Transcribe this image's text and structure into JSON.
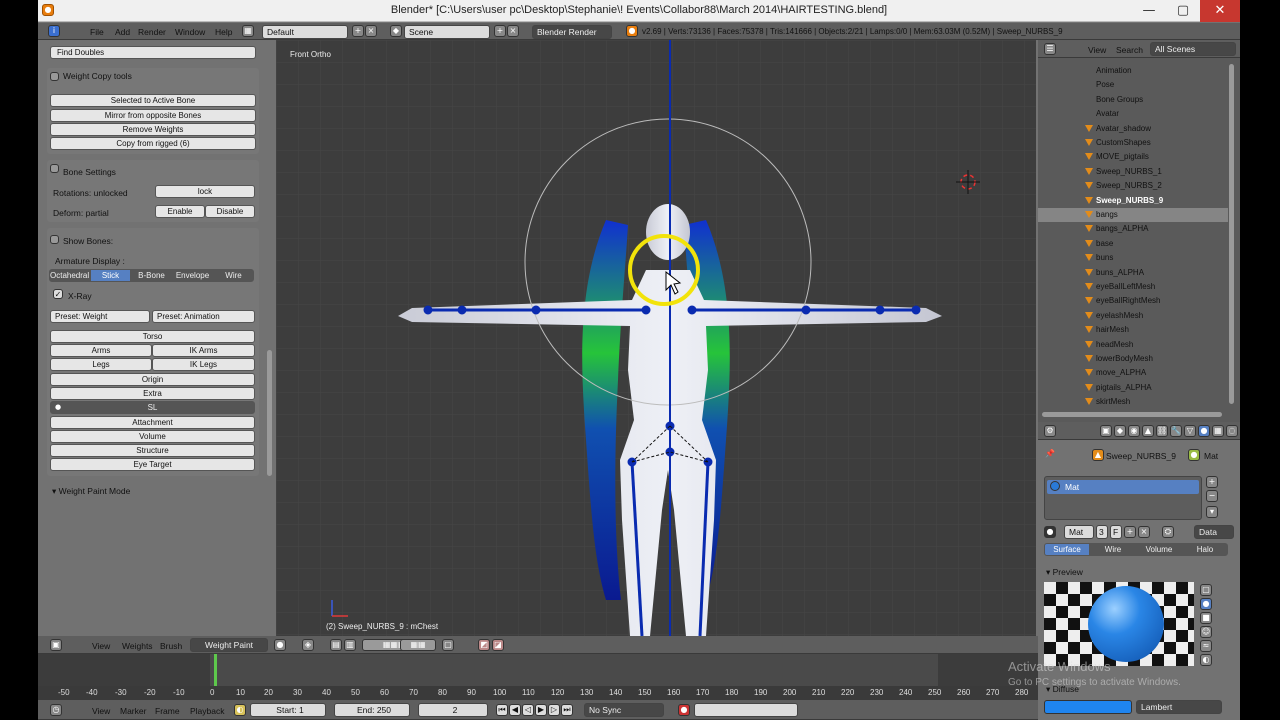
{
  "window": {
    "title": "Blender* [C:\\Users\\user pc\\Desktop\\Stephanie\\! Events\\Collabor88\\March 2014\\HAIRTESTING.blend]"
  },
  "info_bar": {
    "menus": [
      "File",
      "Add",
      "Render",
      "Window",
      "Help"
    ],
    "layout": "Default",
    "scene": "Scene",
    "engine": "Blender Render",
    "stats": "v2.69 | Verts:73136 | Faces:75378 | Tris:141666 | Objects:2/21 | Lamps:0/0 | Mem:63.03M (0.52M) | Sweep_NURBS_9"
  },
  "left_panel": {
    "find_doubles": "Find Doubles",
    "weight_copy": {
      "header": "Weight Copy tools",
      "buttons": [
        "Selected to Active Bone",
        "Mirror from opposite Bones",
        "Remove Weights",
        "Copy from rigged (6)"
      ]
    },
    "bone_settings": {
      "header": "Bone Settings",
      "rotations_label": "Rotations: unlocked",
      "lock_button": "lock",
      "deform_label": "Deform: partial",
      "enable_button": "Enable",
      "disable_button": "Disable"
    },
    "show_bones": {
      "header": "Show Bones:",
      "armature_display_label": "Armature Display :",
      "display_modes": [
        "Octahedral",
        "Stick",
        "B-Bone",
        "Envelope",
        "Wire"
      ],
      "selected_mode": "Stick",
      "xray_label": "X-Ray",
      "preset_weight": "Preset: Weight",
      "preset_animation": "Preset: Animation",
      "layers": {
        "torso": "Torso",
        "arms": "Arms",
        "ik_arms": "IK Arms",
        "legs": "Legs",
        "ik_legs": "IK Legs",
        "origin": "Origin",
        "extra": "Extra",
        "sl": "SL",
        "attachment": "Attachment",
        "volume": "Volume",
        "structure": "Structure",
        "eye_target": "Eye Target"
      }
    },
    "weight_paint_mode": "Weight Paint Mode"
  },
  "viewport": {
    "view_label": "Front Ortho",
    "object_label": "(2) Sweep_NURBS_9 : mChest"
  },
  "viewport_header": {
    "menus": [
      "View",
      "Weights",
      "Brush"
    ],
    "mode": "Weight Paint"
  },
  "outliner": {
    "menus": [
      "View",
      "Search"
    ],
    "filter": "All Scenes",
    "rows": [
      {
        "name": "Animation",
        "kind": "action"
      },
      {
        "name": "Pose",
        "kind": "pose"
      },
      {
        "name": "Bone Groups",
        "kind": "group"
      },
      {
        "name": "Avatar",
        "kind": "item"
      },
      {
        "name": "Avatar_shadow",
        "kind": "mesh"
      },
      {
        "name": "CustomShapes",
        "kind": "mesh"
      },
      {
        "name": "MOVE_pigtails",
        "kind": "mesh"
      },
      {
        "name": "Sweep_NURBS_1",
        "kind": "mesh"
      },
      {
        "name": "Sweep_NURBS_2",
        "kind": "mesh"
      },
      {
        "name": "Sweep_NURBS_9",
        "kind": "mesh",
        "selected": true
      },
      {
        "name": "bangs",
        "kind": "mesh",
        "highlighted": true
      },
      {
        "name": "bangs_ALPHA",
        "kind": "mesh"
      },
      {
        "name": "base",
        "kind": "mesh"
      },
      {
        "name": "buns",
        "kind": "mesh"
      },
      {
        "name": "buns_ALPHA",
        "kind": "mesh"
      },
      {
        "name": "eyeBallLeftMesh",
        "kind": "mesh"
      },
      {
        "name": "eyeBallRightMesh",
        "kind": "mesh"
      },
      {
        "name": "eyelashMesh",
        "kind": "mesh"
      },
      {
        "name": "hairMesh",
        "kind": "mesh"
      },
      {
        "name": "headMesh",
        "kind": "mesh"
      },
      {
        "name": "lowerBodyMesh",
        "kind": "mesh"
      },
      {
        "name": "move_ALPHA",
        "kind": "mesh"
      },
      {
        "name": "pigtails_ALPHA",
        "kind": "mesh"
      },
      {
        "name": "skirtMesh",
        "kind": "mesh"
      }
    ]
  },
  "properties": {
    "breadcrumb_object": "Sweep_NURBS_9",
    "breadcrumb_material": "Mat",
    "material_slot": "Mat",
    "material_name": "Mat",
    "users": "3",
    "fake_user": "F",
    "data_dropdown": "Data",
    "tabs": [
      "Surface",
      "Wire",
      "Volume",
      "Halo"
    ],
    "active_tab": "Surface",
    "preview_header": "Preview",
    "diffuse_header": "Diffuse",
    "shader": "Lambert"
  },
  "timeline": {
    "ticks": [
      "-50",
      "-40",
      "-30",
      "-20",
      "-10",
      "0",
      "10",
      "20",
      "30",
      "40",
      "50",
      "60",
      "70",
      "80",
      "90",
      "100",
      "110",
      "120",
      "130",
      "140",
      "150",
      "160",
      "170",
      "180",
      "190",
      "200",
      "210",
      "220",
      "230",
      "240",
      "250",
      "260",
      "270",
      "280"
    ],
    "current_frame": 2
  },
  "bottom_bar": {
    "menus": [
      "View",
      "Marker",
      "Frame",
      "Playback"
    ],
    "start": "Start: 1",
    "end": "End: 250",
    "current": "2",
    "sync": "No Sync"
  },
  "watermark": {
    "title": "Activate Windows",
    "subtitle": "Go to PC settings to activate Windows."
  },
  "colors": {
    "selected_blue": "#5680c2",
    "viewport_bg": "#3d3d3d",
    "panel_bg": "#727272",
    "brush_circle": "#f2e30a",
    "bone_blue": "#0a2bb0"
  }
}
